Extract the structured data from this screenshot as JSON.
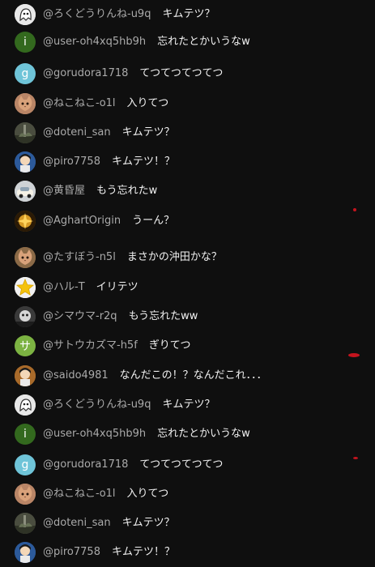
{
  "chat": {
    "messages": [
      {
        "author": "@ろくどうりんね-u9q",
        "text": "キムテツ？",
        "avatar": {
          "kind": "image",
          "icon": "ghost-avatar-icon",
          "bg": "#e8e8e8"
        }
      },
      {
        "author": "@user-oh4xq5hb9h",
        "text": "忘れたとかいうなw",
        "avatar": {
          "kind": "letter",
          "letter": "i",
          "bg": "#33691e"
        }
      },
      {
        "author": "@gorudora1718",
        "text": "てつてつてつてつ",
        "avatar": {
          "kind": "letter",
          "letter": "g",
          "bg": "#6fc4d8"
        }
      },
      {
        "author": "@ねこねこ-o1l",
        "text": "入りてつ",
        "avatar": {
          "kind": "image",
          "icon": "cat-avatar-icon",
          "bg": "#b98566"
        }
      },
      {
        "author": "@doteni_san",
        "text": "キムテツ？",
        "avatar": {
          "kind": "image",
          "icon": "scenery-avatar-icon",
          "bg": "#4a4d3f"
        }
      },
      {
        "author": "@piro7758",
        "text": "キムテツ！？",
        "avatar": {
          "kind": "image",
          "icon": "character-avatar-icon",
          "bg": "#2c5a9b"
        }
      },
      {
        "author": "@黄昏屋",
        "text": "もう忘れたw",
        "avatar": {
          "kind": "image",
          "icon": "car-avatar-icon",
          "bg": "#d9d4c8"
        }
      },
      {
        "author": "@AghartOrigin",
        "text": "うーん？",
        "avatar": {
          "kind": "image",
          "icon": "emblem-avatar-icon",
          "bg": "#8a5a12"
        }
      },
      {
        "author": "@たすぼう-n5l",
        "text": "まさかの沖田かな？",
        "avatar": {
          "kind": "image",
          "icon": "cat-avatar-icon",
          "bg": "#8b6a47"
        }
      },
      {
        "author": "@ハル-T",
        "text": "イリテツ",
        "avatar": {
          "kind": "image",
          "icon": "star-avatar-icon",
          "bg": "#f1f1f1"
        }
      },
      {
        "author": "@シマウマ-r2q",
        "text": "もう忘れたww",
        "avatar": {
          "kind": "image",
          "icon": "shadow-avatar-icon",
          "bg": "#3a3a3a"
        }
      },
      {
        "author": "@サトウカズマ-h5f",
        "text": "ぎりてつ",
        "avatar": {
          "kind": "letter",
          "letter": "サ",
          "bg": "#7cb342"
        }
      },
      {
        "author": "@saido4981",
        "text": "なんだこの！？なんだこれ．．．",
        "avatar": {
          "kind": "image",
          "icon": "character-avatar-icon",
          "bg": "#a86a2a"
        }
      },
      {
        "author": "@ろくどうりんね-u9q",
        "text": "キムテツ？",
        "avatar": {
          "kind": "image",
          "icon": "ghost-avatar-icon",
          "bg": "#e8e8e8"
        }
      },
      {
        "author": "@user-oh4xq5hb9h",
        "text": "忘れたとかいうなw",
        "avatar": {
          "kind": "letter",
          "letter": "i",
          "bg": "#33691e"
        }
      },
      {
        "author": "@gorudora1718",
        "text": "てつてつてつてつ",
        "avatar": {
          "kind": "letter",
          "letter": "g",
          "bg": "#6fc4d8"
        }
      },
      {
        "author": "@ねこねこ-o1l",
        "text": "入りてつ",
        "avatar": {
          "kind": "image",
          "icon": "cat-avatar-icon",
          "bg": "#b98566"
        }
      },
      {
        "author": "@doteni_san",
        "text": "キムテツ？",
        "avatar": {
          "kind": "image",
          "icon": "scenery-avatar-icon",
          "bg": "#4a4d3f"
        }
      },
      {
        "author": "@piro7758",
        "text": "キムテツ！？",
        "avatar": {
          "kind": "image",
          "icon": "character-avatar-icon",
          "bg": "#2c5a9b"
        }
      }
    ]
  },
  "colors": {
    "background": "#0f0f0f",
    "author": "#aaaaaa",
    "message": "#f1f1f1",
    "stray_mark": "#c4141e"
  }
}
